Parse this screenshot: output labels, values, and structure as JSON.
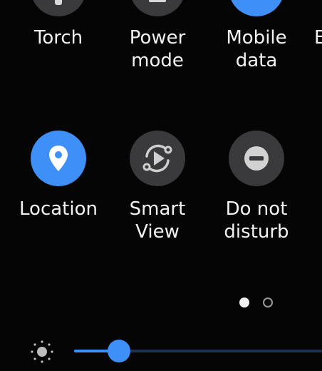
{
  "quick_panel": {
    "tiles_row1": [
      {
        "label_line1": "Torch",
        "label_line2": "",
        "icon": "torch-icon",
        "active": false
      },
      {
        "label_line1": "Power",
        "label_line2": "mode",
        "icon": "power-mode-icon",
        "active": false
      },
      {
        "label_line1": "Mobile",
        "label_line2": "data",
        "icon": "mobile-data-icon",
        "active": true
      },
      {
        "label_line1": "E",
        "label_line2": "",
        "icon": "",
        "active": false
      }
    ],
    "tiles_row2": [
      {
        "label_line1": "Location",
        "label_line2": "",
        "icon": "location-pin-icon",
        "active": true
      },
      {
        "label_line1": "Smart",
        "label_line2": "View",
        "icon": "smart-view-icon",
        "active": false
      },
      {
        "label_line1": "Do not",
        "label_line2": "disturb",
        "icon": "do-not-disturb-icon",
        "active": false
      }
    ],
    "page_indicator": {
      "pages": 2,
      "current": 1
    },
    "brightness": {
      "icon": "brightness-sun-icon",
      "level": 0.18
    },
    "colors": {
      "accent": "#3e8ff7",
      "tile_inactive": "#3a3a3c",
      "background": "#050505",
      "text": "#f2f2f2"
    }
  }
}
